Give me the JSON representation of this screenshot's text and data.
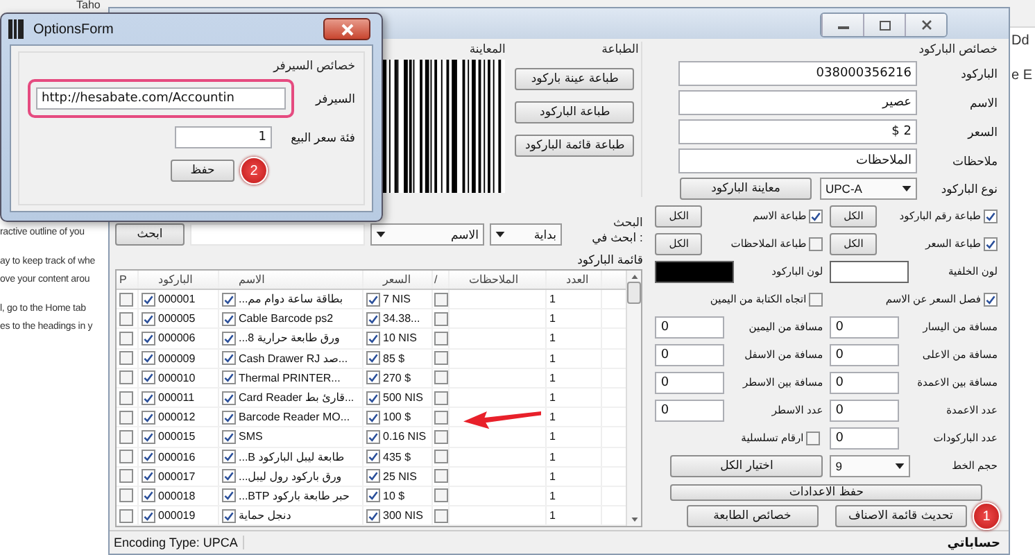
{
  "background_document": {
    "toolbar_text": "Taho",
    "side_texts": [
      "Dd",
      "e E"
    ],
    "lines": [
      "ractive outline of you",
      "ay to keep track of whe",
      "ove your content arou",
      "l, go to the Home tab",
      "es to the headings in y"
    ]
  },
  "main_window": {
    "barcode_properties": {
      "title": "خصائص الباركود",
      "fields": [
        {
          "label": "الباركود",
          "value": "038000356216"
        },
        {
          "label": "الاسم",
          "value": "عصير"
        },
        {
          "label": "السعر",
          "value": "$ 2"
        },
        {
          "label": "ملاحظات",
          "value": "الملاحظات"
        }
      ],
      "type_label": "نوع الباركود",
      "type_value": "UPC-A",
      "preview_button": "معاينة الباركود",
      "print_options": [
        {
          "label": "طباعة رقم الباركود",
          "checked": true,
          "button": "الكل"
        },
        {
          "label": "طباعة الاسم",
          "checked": true,
          "button": "الكل"
        },
        {
          "label": "طباعة السعر",
          "checked": true,
          "button": "الكل"
        },
        {
          "label": "طباعة الملاحظات",
          "checked": false,
          "button": "الكل"
        }
      ],
      "colors": [
        {
          "label": "لون الخلفية",
          "color": "#ffffff"
        },
        {
          "label": "لون الباركود",
          "color": "#000000"
        }
      ],
      "options": [
        {
          "label": "فصل السعر عن الاسم",
          "checked": true
        },
        {
          "label": "اتجاه الكتابة من اليمين",
          "checked": false
        }
      ],
      "spacing": [
        {
          "kind": "number",
          "label": "مسافة من اليسار",
          "value": "0"
        },
        {
          "kind": "number",
          "label": "مسافة من اليمين",
          "value": "0"
        },
        {
          "kind": "number",
          "label": "مسافة من الاعلى",
          "value": "0"
        },
        {
          "kind": "number",
          "label": "مسافة من الاسفل",
          "value": "0"
        },
        {
          "kind": "number",
          "label": "مسافة بين الاعمدة",
          "value": "0"
        },
        {
          "kind": "number",
          "label": "مسافة بين الاسطر",
          "value": "0"
        },
        {
          "kind": "number",
          "label": "عدد الاعمدة",
          "value": "0"
        },
        {
          "kind": "number",
          "label": "عدد الاسطر",
          "value": "0"
        },
        {
          "kind": "number",
          "label": "عدد الباركودات",
          "value": "0"
        },
        {
          "kind": "checkbox",
          "label": "ارقام تسلسلية",
          "checked": false
        }
      ],
      "font_size_label": "حجم الخط",
      "font_size": "9",
      "select_all_button": "اختيار الكل",
      "save_settings_button": "حفظ الاعدادات",
      "update_button": "تحديث قائمة الاصناف",
      "printer_button": "خصائص الطابعة",
      "update_badge": "1"
    },
    "printing": {
      "title": "الطباعة",
      "buttons": [
        "طباعة عينة باركود",
        "طباعة الباركود",
        "طباعة قائمة الباركود"
      ]
    },
    "preview": {
      "title": "المعاينة"
    },
    "search": {
      "title": "البحث",
      "label": "ابحث في :",
      "match": "بداية",
      "field": "الاسم",
      "button": "ابحث"
    },
    "table": {
      "title": "قائمة الباركود",
      "columns": [
        "العدد",
        "الملاحظات",
        "/",
        "السعر",
        "الاسم",
        "الباركود",
        "P"
      ],
      "rows": [
        {
          "p": false,
          "barcode_checked": true,
          "barcode": "000001",
          "name_checked": true,
          "name": "بطاقة ساعة دوام مم...",
          "price_checked": true,
          "price": "7 NIS",
          "slash": false,
          "count": "1"
        },
        {
          "p": false,
          "barcode_checked": true,
          "barcode": "000005",
          "name_checked": true,
          "name": "Cable Barcode ps2",
          "price_checked": true,
          "price": "34.38...",
          "slash": false,
          "count": "1"
        },
        {
          "p": false,
          "barcode_checked": true,
          "barcode": "000006",
          "name_checked": true,
          "name": "ورق طابعة حرارية 8...",
          "price_checked": true,
          "price": "10 NIS",
          "slash": false,
          "count": "1"
        },
        {
          "p": false,
          "barcode_checked": true,
          "barcode": "000009",
          "name_checked": true,
          "name": "Cash Drawer RJ صد...",
          "price_checked": true,
          "price": "85 $",
          "slash": false,
          "count": "1"
        },
        {
          "p": false,
          "barcode_checked": true,
          "barcode": "000010",
          "name_checked": true,
          "name": "Thermal PRINTER...",
          "price_checked": true,
          "price": "270 $",
          "slash": false,
          "count": "1"
        },
        {
          "p": false,
          "barcode_checked": true,
          "barcode": "000011",
          "name_checked": true,
          "name": "Card Reader قارئ بط...",
          "price_checked": true,
          "price": "500 NIS",
          "slash": false,
          "count": "1"
        },
        {
          "p": false,
          "barcode_checked": true,
          "barcode": "000012",
          "name_checked": true,
          "name": "Barcode Reader MO...",
          "price_checked": true,
          "price": "100 $",
          "slash": false,
          "count": "1"
        },
        {
          "p": false,
          "barcode_checked": true,
          "barcode": "000015",
          "name_checked": true,
          "name": "SMS",
          "price_checked": true,
          "price": "0.16 NIS",
          "slash": false,
          "count": "1"
        },
        {
          "p": false,
          "barcode_checked": true,
          "barcode": "000016",
          "name_checked": true,
          "name": "طابعة ليبل الباركود B...",
          "price_checked": true,
          "price": "435 $",
          "slash": false,
          "count": "1"
        },
        {
          "p": false,
          "barcode_checked": true,
          "barcode": "000017",
          "name_checked": true,
          "name": "ورق باركود رول ليبل...",
          "price_checked": true,
          "price": "25 NIS",
          "slash": false,
          "count": "1"
        },
        {
          "p": false,
          "barcode_checked": true,
          "barcode": "000018",
          "name_checked": true,
          "name": "حبر طابعة باركود BTP...",
          "price_checked": true,
          "price": "10 $",
          "slash": false,
          "count": "1"
        },
        {
          "p": false,
          "barcode_checked": true,
          "barcode": "000019",
          "name_checked": true,
          "name": "دنجل حماية",
          "price_checked": true,
          "price": "300 NIS",
          "slash": false,
          "count": "1"
        }
      ]
    },
    "status_bar": "Encoding Type: UPCA",
    "brand": "حساباتي"
  },
  "dialog": {
    "title": "OptionsForm",
    "group_title": "خصائص السيرفر",
    "fields": [
      {
        "label": "السيرفر",
        "value": "http://hesabate.com/Accountin",
        "highlighted": true
      },
      {
        "label": "فئة سعر البيع",
        "value": "1",
        "highlighted": false
      }
    ],
    "save_button": "حفظ",
    "save_badge": "2"
  }
}
